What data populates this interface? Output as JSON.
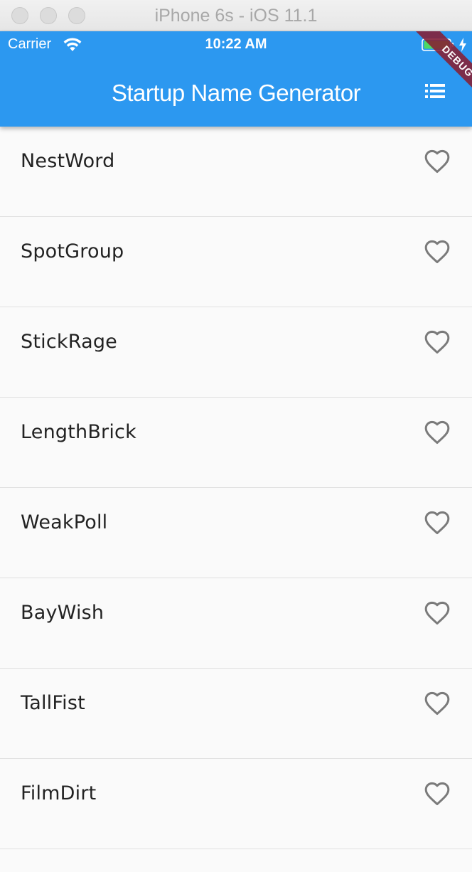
{
  "window": {
    "title": "iPhone 6s - iOS 11.1"
  },
  "status_bar": {
    "carrier": "Carrier",
    "time": "10:22 AM",
    "icons": [
      "wifi-icon",
      "battery-icon",
      "charging-bolt-icon"
    ]
  },
  "app_bar": {
    "title": "Startup Name Generator",
    "action_icon": "list-icon",
    "debug_banner": "DEBUG",
    "color": "#2c98f0"
  },
  "list": {
    "items": [
      {
        "label": "NestWord",
        "favorite": false
      },
      {
        "label": "SpotGroup",
        "favorite": false
      },
      {
        "label": "StickRage",
        "favorite": false
      },
      {
        "label": "LengthBrick",
        "favorite": false
      },
      {
        "label": "WeakPoll",
        "favorite": false
      },
      {
        "label": "BayWish",
        "favorite": false
      },
      {
        "label": "TallFist",
        "favorite": false
      },
      {
        "label": "FilmDirt",
        "favorite": false
      }
    ],
    "item_icon": "heart-outline-icon"
  }
}
